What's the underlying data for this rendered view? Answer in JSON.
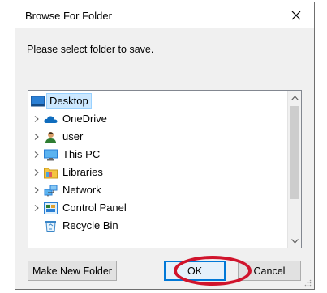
{
  "window": {
    "title": "Browse For Folder",
    "close_icon": "close-icon"
  },
  "instruction": "Please select folder to save.",
  "tree": {
    "selected": "Desktop",
    "items": [
      {
        "label": "Desktop",
        "icon": "desktop-icon",
        "expandable": false,
        "selected": true
      },
      {
        "label": "OneDrive",
        "icon": "onedrive-cloud-icon",
        "expandable": true
      },
      {
        "label": "user",
        "icon": "user-icon",
        "expandable": true
      },
      {
        "label": "This PC",
        "icon": "this-pc-icon",
        "expandable": true
      },
      {
        "label": "Libraries",
        "icon": "libraries-icon",
        "expandable": true
      },
      {
        "label": "Network",
        "icon": "network-icon",
        "expandable": true
      },
      {
        "label": "Control Panel",
        "icon": "control-panel-icon",
        "expandable": true
      },
      {
        "label": "Recycle Bin",
        "icon": "recycle-bin-icon",
        "expandable": false
      }
    ]
  },
  "buttons": {
    "make_new_folder": "Make New Folder",
    "ok": "OK",
    "cancel": "Cancel"
  },
  "colors": {
    "selection": "#cce8ff",
    "ok_border": "#0078d7",
    "highlight": "#d0142c"
  }
}
